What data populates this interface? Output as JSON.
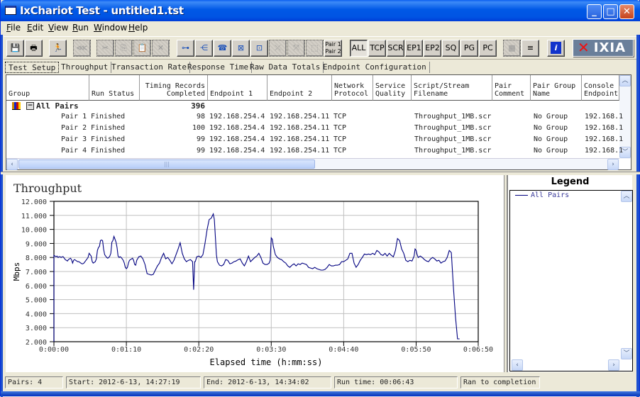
{
  "window": {
    "title": "IxChariot Test - untitled1.tst",
    "controls": {
      "minimize": "_",
      "maximize": "□",
      "close": "✕"
    }
  },
  "menu": [
    {
      "label": "File",
      "accel": "F"
    },
    {
      "label": "Edit",
      "accel": "E"
    },
    {
      "label": "View",
      "accel": "V"
    },
    {
      "label": "Run",
      "accel": "R"
    },
    {
      "label": "Window",
      "accel": "W"
    },
    {
      "label": "Help",
      "accel": "H"
    }
  ],
  "toolbar": {
    "icons": [
      {
        "name": "save-icon",
        "glyph": "💾",
        "enabled": true
      },
      {
        "name": "print-icon",
        "glyph": "🖶",
        "enabled": true
      },
      {
        "name": "run-icon",
        "glyph": "🏃",
        "enabled": true
      },
      {
        "name": "stop-icon",
        "glyph": "⋘",
        "enabled": false
      },
      {
        "name": "cut-icon",
        "glyph": "✂",
        "enabled": false
      },
      {
        "name": "copy-icon",
        "glyph": "⎘",
        "enabled": false
      },
      {
        "name": "paste-icon",
        "glyph": "📋",
        "enabled": false
      },
      {
        "name": "delete-icon",
        "glyph": "✕",
        "enabled": false
      },
      {
        "name": "add-pair-icon",
        "glyph": "⊶",
        "enabled": true
      },
      {
        "name": "add-multicast-icon",
        "glyph": "⋲",
        "enabled": true
      },
      {
        "name": "add-voip-icon",
        "glyph": "☎",
        "enabled": true
      },
      {
        "name": "add-hardware-pair-icon",
        "glyph": "⊠",
        "enabled": true
      },
      {
        "name": "add-hardware-voip-icon",
        "glyph": "⊡",
        "enabled": true
      },
      {
        "name": "edit-pair-icon",
        "glyph": "⤫",
        "enabled": false
      },
      {
        "name": "link-pairs-icon",
        "glyph": "⤧",
        "enabled": false
      },
      {
        "name": "select-pairs-icon",
        "glyph": "⬚",
        "enabled": false
      }
    ],
    "pair_button": {
      "line1": "Pair 1",
      "line2": "Pair 2"
    },
    "filters": [
      "ALL",
      "TCP",
      "SCR",
      "EP1",
      "EP2",
      "SQ",
      "PG",
      "PC"
    ],
    "active_filter": "ALL",
    "extra": [
      {
        "name": "grid-icon",
        "glyph": "▦",
        "enabled": false
      },
      {
        "name": "list-icon",
        "glyph": "≡",
        "enabled": true
      },
      {
        "name": "info-icon",
        "glyph": "i",
        "enabled": true
      }
    ],
    "logo": {
      "x": "✕",
      "text": "IXIA"
    }
  },
  "tabs": [
    {
      "label": "Test Setup",
      "active": true
    },
    {
      "label": "Throughput",
      "active": false
    },
    {
      "label": "Transaction Rate",
      "active": false
    },
    {
      "label": "Response Time",
      "active": false
    },
    {
      "label": "Raw Data Totals",
      "active": false
    },
    {
      "label": "Endpoint Configuration",
      "active": false
    }
  ],
  "grid": {
    "columns": [
      "Group",
      "Run Status",
      "Timing Records\nCompleted",
      "Endpoint 1",
      "Endpoint 2",
      "Network\nProtocol",
      "Service\nQuality",
      "Script/Stream\nFilename",
      "Pair\nComment",
      "Pair Group\nName",
      "Console\nEndpoint"
    ],
    "group_row": {
      "name": "All Pairs",
      "records": "396",
      "collapse": "−"
    },
    "rows": [
      {
        "pair": "Pair 1",
        "status": "Finished",
        "records": "98",
        "ep1": "192.168.254.4",
        "ep2": "192.168.254.11",
        "protocol": "TCP",
        "qos": "",
        "script": "Throughput_1MB.scr",
        "comment": "",
        "group": "No Group",
        "console": "192.168.1"
      },
      {
        "pair": "Pair 2",
        "status": "Finished",
        "records": "100",
        "ep1": "192.168.254.4",
        "ep2": "192.168.254.11",
        "protocol": "TCP",
        "qos": "",
        "script": "Throughput_1MB.scr",
        "comment": "",
        "group": "No Group",
        "console": "192.168.1"
      },
      {
        "pair": "Pair 3",
        "status": "Finished",
        "records": "99",
        "ep1": "192.168.254.4",
        "ep2": "192.168.254.11",
        "protocol": "TCP",
        "qos": "",
        "script": "Throughput_1MB.scr",
        "comment": "",
        "group": "No Group",
        "console": "192.168.1"
      },
      {
        "pair": "Pair 4",
        "status": "Finished",
        "records": "99",
        "ep1": "192.168.254.4",
        "ep2": "192.168.254.11",
        "protocol": "TCP",
        "qos": "",
        "script": "Throughput_1MB.scr",
        "comment": "",
        "group": "No Group",
        "console": "192.168.1"
      }
    ]
  },
  "legend": {
    "title": "Legend",
    "entries": [
      {
        "label": "All Pairs",
        "color": "#000080"
      }
    ]
  },
  "status": {
    "pairs": "Pairs: 4",
    "start": "Start: 2012-6-13, 14:27:19",
    "end": "End: 2012-6-13, 14:34:02",
    "runtime": "Run time: 00:06:43",
    "state": "Ran to completion"
  },
  "chart_data": {
    "type": "line",
    "title": "Throughput",
    "xlabel": "Elapsed time (h:mm:ss)",
    "ylabel": "Mbps",
    "xlim": [
      0,
      410
    ],
    "ylim": [
      2,
      12
    ],
    "grid": true,
    "legend": "right-panel",
    "yticks": [
      "2.000",
      "3.000",
      "4.000",
      "5.000",
      "6.000",
      "7.000",
      "8.000",
      "9.000",
      "10.000",
      "11.000",
      "12.000"
    ],
    "xticks": [
      {
        "v": 0,
        "label": "0:00:00"
      },
      {
        "v": 70,
        "label": "0:01:10"
      },
      {
        "v": 140,
        "label": "0:02:20"
      },
      {
        "v": 210,
        "label": "0:03:30"
      },
      {
        "v": 280,
        "label": "0:04:40"
      },
      {
        "v": 350,
        "label": "0:05:50"
      },
      {
        "v": 410,
        "label": "0:06:50"
      }
    ],
    "series": [
      {
        "name": "All Pairs",
        "color": "#000080",
        "x": [
          0,
          1,
          2,
          3,
          4,
          5,
          6,
          7,
          8,
          9,
          10,
          11,
          12,
          13,
          14,
          15,
          16,
          17,
          18,
          19,
          20,
          21,
          22,
          23,
          24,
          25,
          26,
          27,
          28,
          29,
          30,
          31,
          32,
          33,
          34,
          35,
          36,
          37,
          38,
          39,
          40,
          41,
          42,
          43,
          44,
          45,
          46,
          47,
          48,
          49,
          50,
          51,
          52,
          53,
          54,
          55,
          56,
          57,
          58,
          59,
          60,
          61,
          62,
          63,
          64,
          65,
          66,
          67,
          68,
          69,
          70,
          71,
          72,
          73,
          74,
          75,
          76,
          77,
          78,
          79,
          80,
          82,
          84,
          86,
          88,
          90,
          92,
          94,
          96,
          98,
          100,
          102,
          104,
          106,
          108,
          110,
          112,
          114,
          116,
          118,
          120,
          122,
          124,
          126,
          128,
          130,
          132,
          134,
          135,
          136,
          136.5,
          137,
          138,
          140,
          142,
          144,
          146,
          148,
          150,
          152,
          154,
          155,
          156,
          157,
          158,
          160,
          162,
          164,
          166,
          168,
          170,
          172,
          174,
          176,
          178,
          180,
          182,
          184,
          186,
          188,
          190,
          192,
          194,
          196,
          198,
          200,
          202,
          204,
          206,
          208,
          209,
          210,
          211,
          212,
          214,
          216,
          218,
          220,
          222,
          224,
          226,
          228,
          230,
          232,
          234,
          236,
          238,
          240,
          242,
          244,
          246,
          248,
          250,
          252,
          254,
          256,
          258,
          260,
          262,
          264,
          266,
          268,
          270,
          272,
          274,
          276,
          278,
          280,
          282,
          284,
          286,
          288,
          290,
          292,
          294,
          296,
          298,
          300,
          302,
          304,
          306,
          308,
          310,
          312,
          314,
          316,
          318,
          320,
          322,
          324,
          326,
          328,
          330,
          332,
          334,
          336,
          338,
          340,
          342,
          344,
          346,
          348,
          349,
          350,
          351,
          352,
          354,
          356,
          358,
          360,
          362,
          364,
          366,
          368,
          370,
          372,
          374,
          376,
          378,
          380,
          382,
          384,
          386,
          388,
          390,
          392,
          394,
          396,
          397,
          398,
          398.5,
          399,
          400,
          401
        ],
        "y": [
          8.15,
          8.1,
          8.05,
          8.1,
          8.0,
          8.05,
          8.05,
          8.0,
          8.05,
          8.05,
          7.95,
          7.85,
          7.8,
          7.75,
          7.85,
          7.9,
          7.95,
          7.85,
          7.6,
          7.8,
          7.85,
          7.8,
          7.75,
          7.7,
          7.7,
          7.65,
          7.6,
          7.55,
          7.55,
          7.6,
          7.7,
          7.8,
          7.9,
          8.0,
          8.3,
          8.2,
          8.1,
          7.7,
          7.6,
          7.65,
          7.7,
          7.9,
          8.5,
          8.7,
          8.8,
          9.2,
          9.25,
          9.2,
          8.6,
          8.2,
          8.1,
          8.0,
          7.95,
          8.0,
          8.1,
          8.3,
          9.1,
          9.2,
          9.5,
          9.3,
          9.1,
          8.7,
          8.1,
          8.0,
          8.05,
          8.0,
          7.9,
          7.8,
          7.6,
          7.3,
          7.2,
          7.3,
          7.6,
          7.8,
          7.85,
          7.9,
          7.95,
          7.8,
          7.5,
          7.45,
          7.8,
          8.05,
          8.1,
          7.9,
          7.5,
          6.85,
          6.8,
          6.75,
          6.8,
          7.1,
          7.4,
          7.6,
          8.0,
          8.3,
          7.9,
          8.0,
          7.8,
          7.55,
          7.8,
          8.2,
          8.6,
          9.05,
          8.3,
          7.9,
          7.7,
          7.8,
          7.85,
          7.7,
          5.7,
          7.7,
          7.7,
          7.8,
          8.05,
          8.1,
          8.0,
          8.2,
          9.0,
          10.0,
          10.7,
          10.8,
          11.1,
          10.7,
          9.5,
          8.2,
          7.7,
          7.45,
          7.4,
          7.5,
          7.85,
          7.8,
          7.55,
          7.6,
          7.7,
          7.75,
          7.85,
          7.9,
          7.6,
          7.4,
          7.7,
          8.1,
          7.7,
          7.85,
          8.0,
          8.1,
          8.3,
          8.0,
          7.6,
          7.5,
          7.5,
          7.6,
          7.8,
          9.4,
          9.3,
          8.8,
          8.2,
          8.0,
          7.9,
          7.85,
          7.7,
          7.6,
          7.4,
          7.3,
          7.45,
          7.55,
          7.4,
          7.55,
          7.5,
          7.6,
          7.55,
          7.5,
          7.3,
          7.25,
          7.2,
          7.3,
          7.2,
          7.15,
          7.1,
          7.1,
          7.15,
          7.3,
          7.5,
          7.4,
          7.4,
          7.45,
          7.45,
          7.5,
          7.7,
          7.7,
          7.8,
          7.9,
          8.3,
          8.3,
          7.6,
          7.3,
          7.5,
          7.8,
          8.0,
          8.25,
          8.2,
          8.25,
          8.2,
          8.3,
          8.2,
          8.5,
          8.4,
          8.2,
          8.15,
          8.3,
          8.1,
          8.3,
          8.15,
          8.05,
          8.5,
          9.35,
          9.2,
          8.6,
          8.3,
          7.8,
          7.7,
          7.8,
          7.75,
          8.1,
          8.6,
          8.5,
          8.2,
          8.0,
          8.1,
          8.0,
          7.85,
          7.75,
          7.7,
          7.9,
          8.0,
          7.9,
          7.75,
          7.8,
          7.6,
          7.7,
          7.75,
          8.0,
          8.5,
          8.35,
          5.9,
          3.8,
          2.2,
          2.2
        ]
      }
    ]
  }
}
